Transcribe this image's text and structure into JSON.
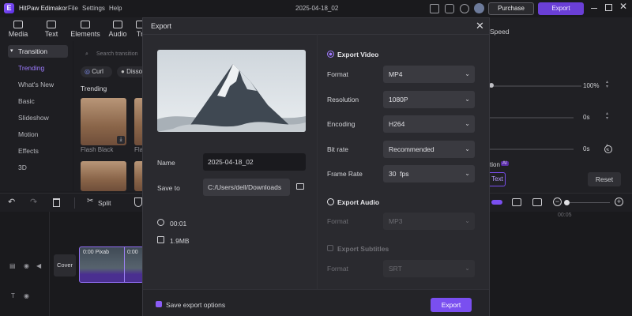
{
  "titlebar": {
    "app_name": "HitPaw Edimakor",
    "menu": [
      "File",
      "Settings",
      "Help"
    ],
    "project_title": "2025-04-18_02",
    "purchase_label": "Purchase",
    "export_label": "Export"
  },
  "media_tabs": [
    "Media",
    "Text",
    "Elements",
    "Audio",
    "Tr"
  ],
  "sidebar": {
    "section": "Transition",
    "items": [
      "Trending",
      "What's New",
      "Basic",
      "Slideshow",
      "Motion",
      "Effects",
      "3D"
    ]
  },
  "content": {
    "search_placeholder": "Search transition",
    "chips": [
      "Curl",
      "Disso"
    ],
    "heading": "Trending",
    "thumb_labels": [
      "Flash Black",
      "Fla"
    ]
  },
  "timeline": {
    "split_label": "Split",
    "clip_labels": [
      "0:00 Pixab",
      "0:00"
    ],
    "cover_label": "Cover",
    "ruler_mark": "00:05"
  },
  "right_panel": {
    "speed_label": "Speed",
    "percent_value": "100%",
    "time_values": [
      "0s",
      "0s",
      "0s"
    ],
    "partial_label": "tion",
    "ai_badge": "AI",
    "text_btn": "Text",
    "reset_label": "Reset"
  },
  "modal": {
    "title": "Export",
    "name_label": "Name",
    "name_value": "2025-04-18_02",
    "save_to_label": "Save to",
    "save_to_value": "C:/Users/dell/Downloads",
    "duration": "00:01",
    "size": "1.9MB",
    "export_video_label": "Export Video",
    "format_label": "Format",
    "format_value": "MP4",
    "resolution_label": "Resolution",
    "resolution_value": "1080P",
    "encoding_label": "Encoding",
    "encoding_value": "H264",
    "bitrate_label": "Bit rate",
    "bitrate_value": "Recommended",
    "framerate_label": "Frame Rate",
    "framerate_value": "30  fps",
    "export_audio_label": "Export Audio",
    "audio_format_label": "Format",
    "audio_format_value": "MP3",
    "export_subtitles_label": "Export Subtitles",
    "subtitle_format_label": "Format",
    "subtitle_format_value": "SRT",
    "save_options_label": "Save export options",
    "export_button": "Export",
    "close_icon": "close-icon"
  }
}
